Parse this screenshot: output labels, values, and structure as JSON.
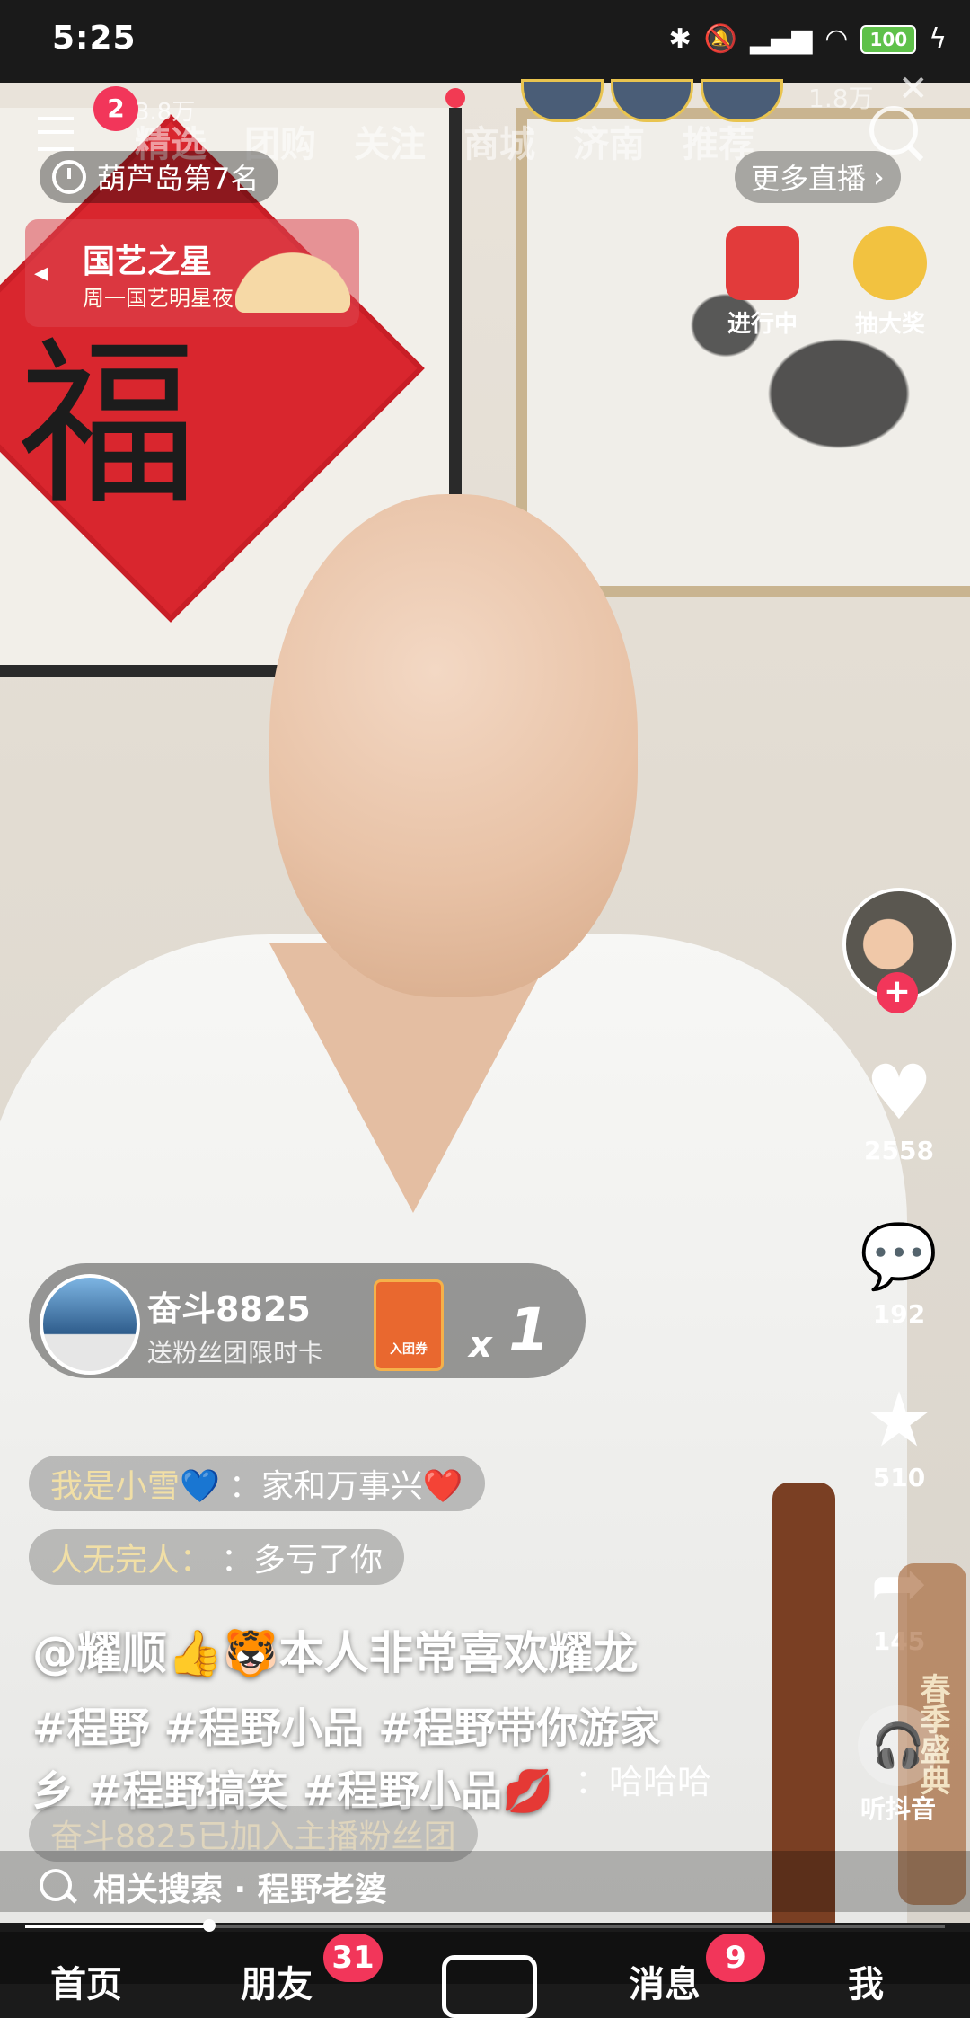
{
  "status_bar": {
    "time": "5:25",
    "battery": "100"
  },
  "top_nav": {
    "tabs": [
      "精选",
      "团购",
      "关注",
      "商城",
      "济南",
      "推荐"
    ],
    "menu_badge": "2",
    "likes": "3.8万",
    "viewer_count": "1.8万"
  },
  "rank": {
    "label": "葫芦岛第7名"
  },
  "more_live": {
    "label": "更多直播"
  },
  "star_card": {
    "title": "国艺之星",
    "subtitle": "周一国艺明星夜"
  },
  "activities": [
    {
      "label": "进行中"
    },
    {
      "label": "抽大奖"
    }
  ],
  "side_actions": {
    "likes": "2558",
    "comments": "192",
    "favorites": "510",
    "shares": "145",
    "listen": "听抖音",
    "festival": "春季盛典"
  },
  "gift": {
    "sender": "奋斗8825",
    "description": "送粉丝团限时卡",
    "card_label": "入团券",
    "count": "1"
  },
  "comments": [
    {
      "user": "我是小雪💙",
      "text": "：家和万事兴❤️"
    },
    {
      "user": "人无完人：",
      "text": "：多亏了你"
    }
  ],
  "caption": {
    "user_line": "@耀顺👍🐯本人非常喜欢耀龙",
    "tags_line1": "#程野 #程野小品 #程野带你游家",
    "tags_line2": "乡 #程野搞笑 #程野小品💋",
    "inline_comment": "：哈哈哈"
  },
  "join_notice": "奋斗8825已加入主播粉丝团",
  "related_search": {
    "label": "相关搜索 · 程野老婆"
  },
  "progress": 0.2,
  "bottom_nav": {
    "items": [
      "首页",
      "朋友",
      "消息",
      "我"
    ],
    "friends_badge": "31",
    "messages_badge": "9"
  },
  "colors": {
    "accent": "#f2365a",
    "comment_user": "#f1dfa6",
    "battery": "#5fc14a"
  }
}
